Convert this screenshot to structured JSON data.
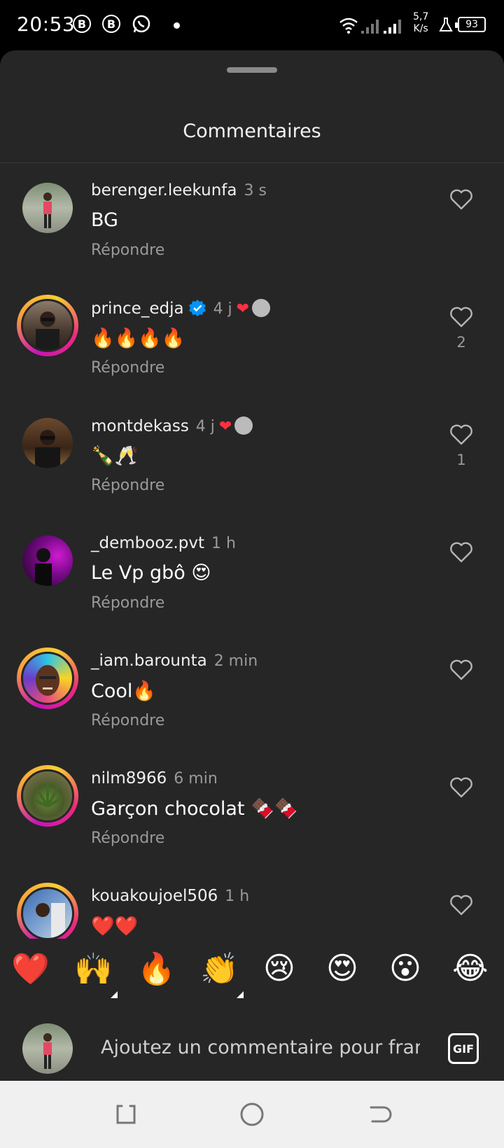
{
  "status_bar": {
    "time": "20:53",
    "icons": [
      "B",
      "B"
    ],
    "speed_top": "5,7",
    "speed_bottom": "K/s",
    "battery": "93"
  },
  "sheet": {
    "title": "Commentaires"
  },
  "comments": [
    {
      "username": "berenger.leekunfa",
      "time": "3 s",
      "text": "BG",
      "reply": "Répondre",
      "likes": ""
    },
    {
      "username": "prince_edja",
      "time": "4 j",
      "text": "🔥🔥🔥🔥",
      "reply": "Répondre",
      "likes": "2"
    },
    {
      "username": "montdekass",
      "time": "4 j",
      "text": "🍾🥂",
      "reply": "Répondre",
      "likes": "1"
    },
    {
      "username": "_dembooz.pvt",
      "time": "1 h",
      "text": "Le Vp gbô 😍",
      "reply": "Répondre",
      "likes": ""
    },
    {
      "username": "_iam.barounta",
      "time": "2 min",
      "text": "Cool🔥",
      "reply": "Répondre",
      "likes": ""
    },
    {
      "username": "nilm8966",
      "time": "6 min",
      "text": "Garçon chocolat 🍫🍫",
      "reply": "Répondre",
      "likes": ""
    },
    {
      "username": "kouakoujoel506",
      "time": "1 h",
      "text": "❤️❤️",
      "reply": "",
      "likes": ""
    }
  ],
  "emoji_bar": [
    "❤️",
    "🙌",
    "🔥",
    "👏",
    "😢",
    "😍",
    "😮",
    "😂"
  ],
  "input": {
    "placeholder": "Ajoutez un commentaire pour franck",
    "gif_label": "GIF"
  },
  "colors": {
    "background": "#262626",
    "like_red": "#ff3040",
    "verified_blue": "#0095f6"
  }
}
